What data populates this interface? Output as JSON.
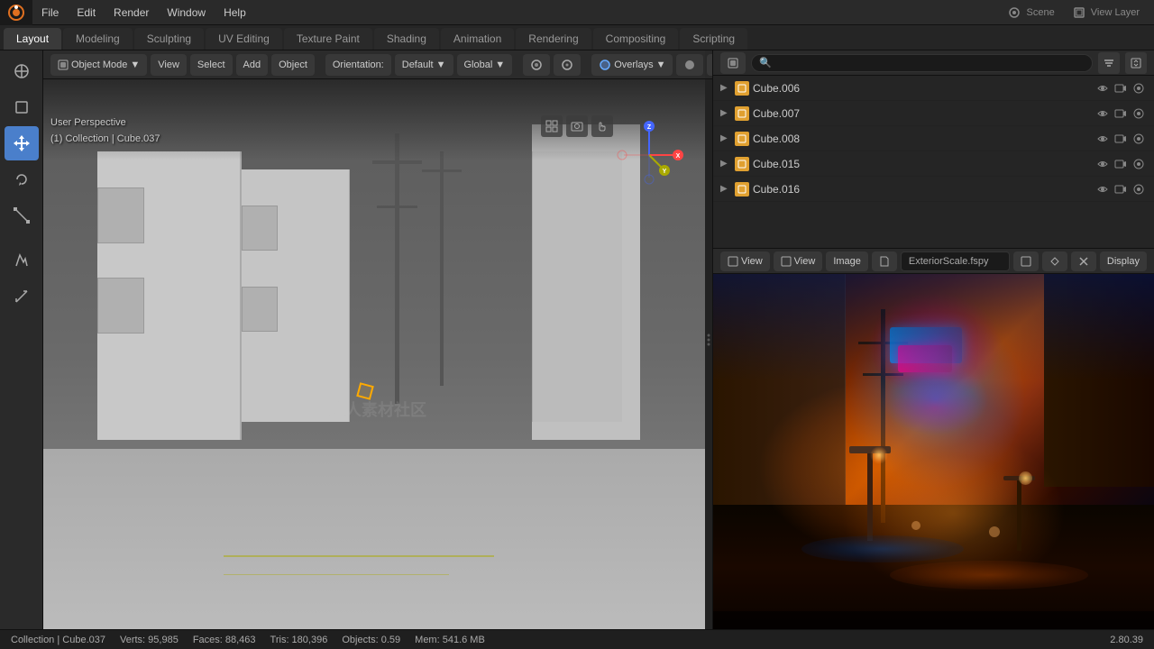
{
  "app": {
    "title": "Blender"
  },
  "topMenu": {
    "items": [
      {
        "label": "File",
        "id": "file"
      },
      {
        "label": "Edit",
        "id": "edit"
      },
      {
        "label": "Render",
        "id": "render"
      },
      {
        "label": "Window",
        "id": "window"
      },
      {
        "label": "Help",
        "id": "help"
      }
    ]
  },
  "workspaceTabs": [
    {
      "label": "Layout",
      "active": true
    },
    {
      "label": "Modeling",
      "active": false
    },
    {
      "label": "Sculpting",
      "active": false
    },
    {
      "label": "UV Editing",
      "active": false
    },
    {
      "label": "Texture Paint",
      "active": false
    },
    {
      "label": "Shading",
      "active": false
    },
    {
      "label": "Animation",
      "active": false
    },
    {
      "label": "Rendering",
      "active": false
    },
    {
      "label": "Compositing",
      "active": false
    },
    {
      "label": "Scripting",
      "active": false
    }
  ],
  "topRight": {
    "scene": "Scene",
    "viewLayer": "View Layer"
  },
  "viewport": {
    "orientation": "Orientation:",
    "orientationValue": "Default",
    "mode": "Object Mode",
    "view": "View",
    "select": "Select",
    "add": "Add",
    "object": "Object",
    "global": "Global",
    "overlays": "Overlays",
    "info": {
      "perspective": "User Perspective",
      "collection": "(1) Collection | Cube.037"
    }
  },
  "outliner": {
    "items": [
      {
        "name": "Cube.006",
        "type": "mesh"
      },
      {
        "name": "Cube.007",
        "type": "mesh"
      },
      {
        "name": "Cube.008",
        "type": "mesh"
      },
      {
        "name": "Cube.015",
        "type": "mesh"
      },
      {
        "name": "Cube.016",
        "type": "mesh"
      }
    ]
  },
  "propertiesPanel": {
    "viewBtn": "View",
    "viewBtn2": "View",
    "imageBtn": "Image",
    "filename": "ExteriorScale.fspy",
    "displayBtn": "Display"
  },
  "statusBar": {
    "collection": "Collection | Cube.037",
    "verts": "Verts: 95,985",
    "faces": "Faces: 88,463",
    "tris": "Tris: 180,396",
    "objects": "Objects: 0.59",
    "mem": "Mem: 541.6 MB",
    "version": "2.80.39"
  },
  "renderInfo": {
    "bottom": ""
  },
  "icons": {
    "logo": "●",
    "cursor": "⊕",
    "select": "◻",
    "transform": "✥",
    "scale": "⤡",
    "annotate": "✏",
    "measure": "📐",
    "eye": "👁",
    "camera": "📷",
    "lock": "🔒",
    "filter": "≡",
    "mesh": "▣",
    "arrow_right": "▶",
    "arrow_down": "▼"
  }
}
